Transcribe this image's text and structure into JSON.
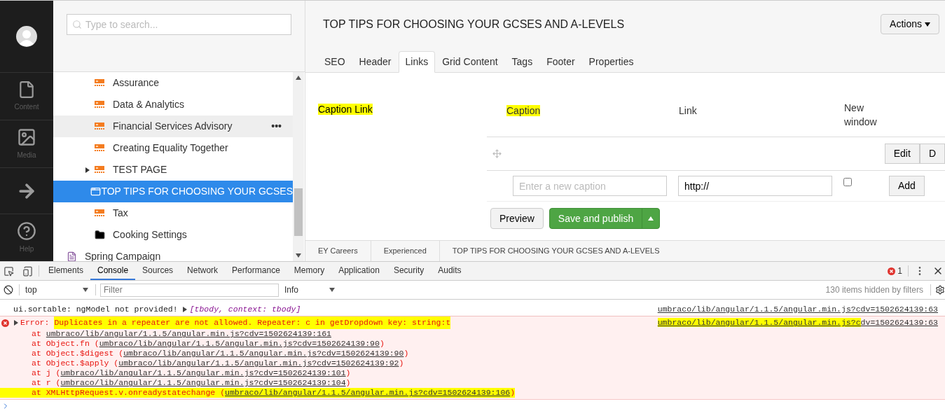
{
  "sidebar": {
    "sections": [
      {
        "kind": "content",
        "label": "Content"
      },
      {
        "kind": "media",
        "label": "Media"
      },
      {
        "kind": "arrow"
      },
      {
        "kind": "help",
        "label": "Help"
      }
    ]
  },
  "search": {
    "placeholder": "Type to search..."
  },
  "tree": [
    {
      "kind": "group",
      "children": [
        {
          "label": "Assurance",
          "kind": "grid",
          "selected": false,
          "hovered": false,
          "expandable": false
        },
        {
          "label": "Data & Analytics",
          "kind": "grid",
          "selected": false,
          "hovered": false,
          "expandable": false
        },
        {
          "label": "Financial Services Advisory",
          "kind": "grid",
          "selected": false,
          "hovered": true,
          "expandable": false,
          "actions": "•••"
        },
        {
          "label": "Creating Equality Together",
          "kind": "grid",
          "selected": false,
          "hovered": false,
          "expandable": false
        },
        {
          "label": "TEST PAGE",
          "kind": "grid",
          "selected": false,
          "hovered": false,
          "expandable": true
        },
        {
          "label": "TOP TIPS FOR CHOOSING YOUR GCSES",
          "kind": "window",
          "selected": true,
          "hovered": false,
          "expandable": false
        },
        {
          "label": "Tax",
          "kind": "grid",
          "selected": false,
          "hovered": false,
          "expandable": false
        },
        {
          "label": "Cooking Settings",
          "kind": "folder",
          "selected": false,
          "hovered": false,
          "expandable": false
        }
      ]
    },
    {
      "kind": "doc",
      "label": "Spring Campaign",
      "selected": false,
      "hovered": false,
      "expandable": false
    }
  ],
  "editor": {
    "title": "TOP TIPS FOR CHOOSING YOUR GCSES AND A-LEVELS",
    "actions": "Actions",
    "tabs": [
      {
        "label": "SEO",
        "selected": false
      },
      {
        "label": "Header",
        "selected": false
      },
      {
        "label": "Links",
        "selected": true
      },
      {
        "label": "Grid Content",
        "selected": false
      },
      {
        "label": "Tags",
        "selected": false
      },
      {
        "label": "Footer",
        "selected": false
      },
      {
        "label": "Properties",
        "selected": false
      }
    ],
    "property_label": {
      "text": "Caption Link",
      "highlighted": true
    },
    "columns": [
      {
        "text": "Caption",
        "highlighted": true
      },
      {
        "text": "Link",
        "highlighted": false
      },
      {
        "text": "New window",
        "highlighted": false
      }
    ],
    "row_buttons": [
      "Edit",
      "D"
    ],
    "new_row": {
      "caption_placeholder": "Enter a new caption",
      "link_value": "http://",
      "new_window": false,
      "add": "Add"
    },
    "preview": "Preview",
    "save": "Save and publish",
    "breadcrumb": [
      "EY Careers",
      "Experienced",
      "TOP TIPS FOR CHOOSING YOUR GCSES AND A-LEVELS"
    ]
  },
  "devtools": {
    "tabs": [
      {
        "label": "Elements",
        "selected": false
      },
      {
        "label": "Console",
        "selected": true
      },
      {
        "label": "Sources",
        "selected": false
      },
      {
        "label": "Network",
        "selected": false
      },
      {
        "label": "Performance",
        "selected": false
      },
      {
        "label": "Memory",
        "selected": false
      },
      {
        "label": "Application",
        "selected": false
      },
      {
        "label": "Security",
        "selected": false
      },
      {
        "label": "Audits",
        "selected": false
      }
    ],
    "error_count": "1",
    "context": "top",
    "filter_placeholder": "Filter",
    "level": "Info",
    "hidden": "130 items hidden by filters",
    "messages": [
      {
        "kind": "log",
        "text": "ui.sortable: ngModel not provided!",
        "object": "[tbody, context: tbody]",
        "source": [
          {
            "text": "umbraco/lib/angular/1.1.5/angular.min.js?cdv=1502624139:63",
            "highlighted": false
          }
        ]
      },
      {
        "kind": "error",
        "label": "Error:",
        "text": "Duplicates in a repeater are not allowed. Repeater: c in getDropdown key: string:t",
        "highlighted": true,
        "source": [
          {
            "text": "umbraco/lib/angular/1.1.5/angular.min.js?c",
            "highlighted": true
          },
          {
            "text": "dv=1502624139:63",
            "highlighted": false
          }
        ],
        "stack": [
          {
            "prefix": "at",
            "link": "umbraco/lib/angular/1.1.5/angular.min.js?cdv=1502624139:161",
            "highlighted": false
          },
          {
            "prefix": "at Object.fn (",
            "link": "umbraco/lib/angular/1.1.5/angular.min.js?cdv=1502624139:90",
            "suffix": ")",
            "highlighted": false
          },
          {
            "prefix": "at Object.$digest (",
            "link": "umbraco/lib/angular/1.1.5/angular.min.js?cdv=1502624139:90",
            "suffix": ")",
            "highlighted": false
          },
          {
            "prefix": "at Object.$apply (",
            "link": "umbraco/lib/angular/1.1.5/angular.min.js?cdv=1502624139:92",
            "suffix": ")",
            "highlighted": false
          },
          {
            "prefix": "at j (",
            "link": "umbraco/lib/angular/1.1.5/angular.min.js?cdv=1502624139:101",
            "suffix": ")",
            "highlighted": false
          },
          {
            "prefix": "at r (",
            "link": "umbraco/lib/angular/1.1.5/angular.min.js?cdv=1502624139:104",
            "suffix": ")",
            "highlighted": false
          },
          {
            "prefix": "at XMLHttpRequest.v.onreadystatechange (",
            "link": "umbraco/lib/angular/1.1.5/angular.min.js?cdv=1502624139:106",
            "suffix": ")",
            "highlighted": true
          }
        ]
      }
    ]
  }
}
